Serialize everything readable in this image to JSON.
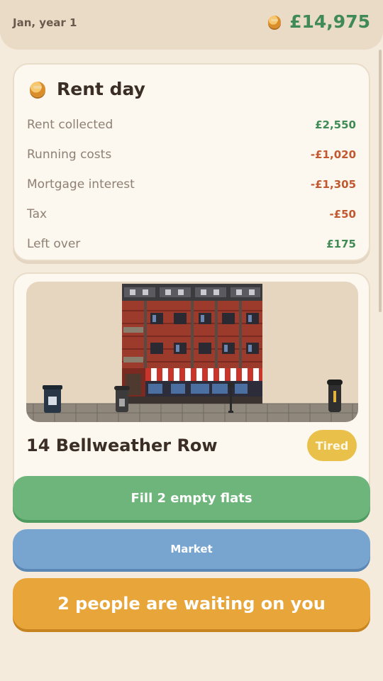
{
  "header": {
    "date": "Jan, year 1",
    "balance": "£14,975",
    "balance_icon": "coin-icon"
  },
  "rent_day": {
    "title": "Rent day",
    "icon": "coin-icon",
    "rows": [
      {
        "label": "Rent collected",
        "value": "£2,550",
        "tone": "positive"
      },
      {
        "label": "Running costs",
        "value": "-£1,020",
        "tone": "negative"
      },
      {
        "label": "Mortgage interest",
        "value": "-£1,305",
        "tone": "negative"
      },
      {
        "label": "Tax",
        "value": "-£50",
        "tone": "negative"
      },
      {
        "label": "Left over",
        "value": "£175",
        "tone": "positive"
      }
    ]
  },
  "property": {
    "name": "14 Bellweather Row",
    "condition": "Tired"
  },
  "actions": {
    "fill": "Fill 2 empty flats",
    "market": "Market",
    "waiting": "2 people are waiting on you"
  },
  "colors": {
    "positive": "#3f8a56",
    "negative": "#c2582f",
    "fill_button": "#6db57a",
    "market_button": "#77a5d0",
    "waiting_button": "#e8a53a",
    "badge": "#e9c14a"
  }
}
